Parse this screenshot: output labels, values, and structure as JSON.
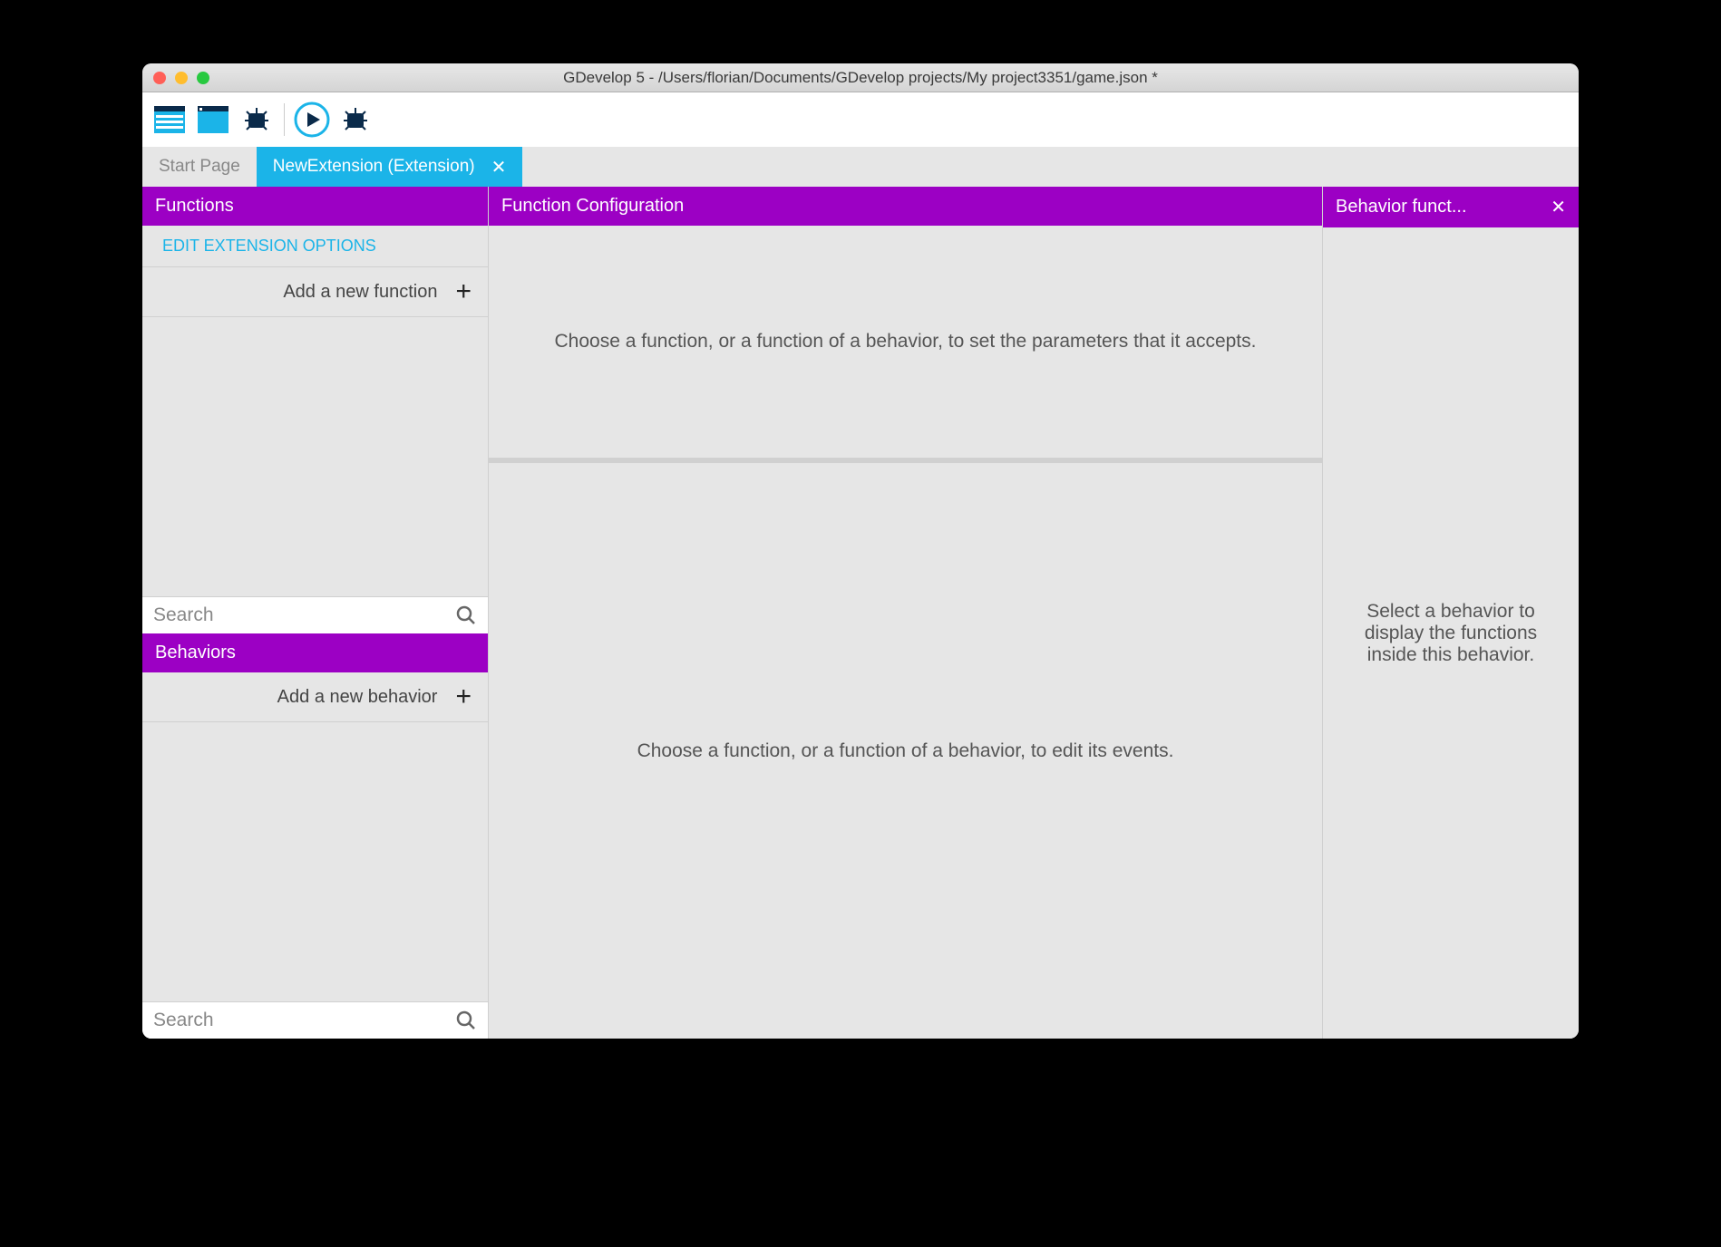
{
  "window": {
    "title": "GDevelop 5 - /Users/florian/Documents/GDevelop projects/My project3351/game.json *"
  },
  "tabs": [
    {
      "label": "Start Page",
      "active": false,
      "closable": false
    },
    {
      "label": "NewExtension (Extension)",
      "active": true,
      "closable": true
    }
  ],
  "colors": {
    "accent_purple": "#9c00c4",
    "accent_cyan": "#1bb4e8"
  },
  "left": {
    "functions_header": "Functions",
    "edit_options": "Edit Extension Options",
    "add_function": "Add a new function",
    "search_placeholder": "Search",
    "behaviors_header": "Behaviors",
    "add_behavior": "Add a new behavior",
    "search_placeholder2": "Search"
  },
  "center": {
    "config_header": "Function Configuration",
    "config_body": "Choose a function, or a function of a behavior, to set the parameters that it accepts.",
    "events_body": "Choose a function, or a function of a behavior, to edit its events."
  },
  "right": {
    "header": "Behavior funct...",
    "body": "Select a behavior to display the functions inside this behavior."
  }
}
